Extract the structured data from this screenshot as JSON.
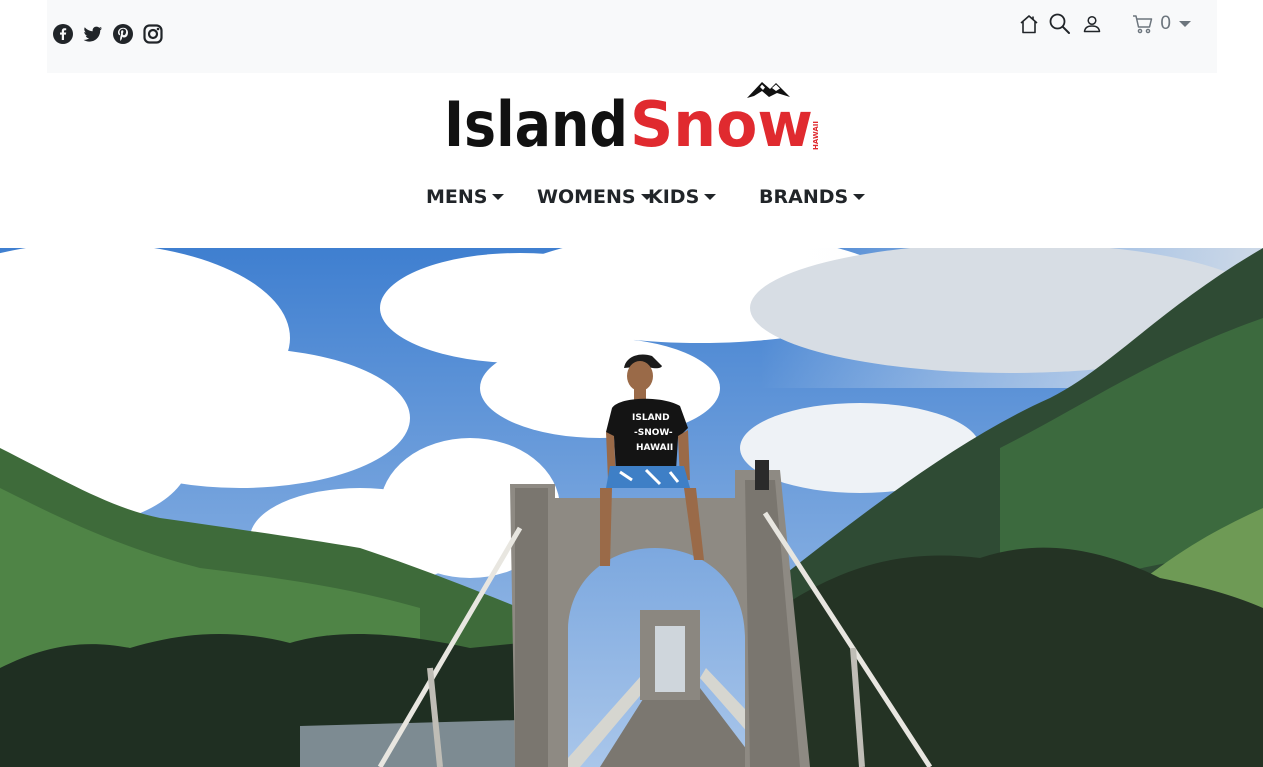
{
  "social": {
    "icons": [
      "facebook-icon",
      "twitter-icon",
      "pinterest-icon",
      "instagram-icon"
    ]
  },
  "header": {
    "cart_count": "0",
    "icons": [
      "home-icon",
      "search-icon",
      "user-icon",
      "cart-icon",
      "chevron-down-icon"
    ]
  },
  "logo": {
    "text_black": "Island",
    "text_red": "Snow",
    "tag": "HAWAII",
    "colors": {
      "black": "#111111",
      "red": "#e02a2f"
    }
  },
  "nav": {
    "items": [
      {
        "label": "MENS"
      },
      {
        "label": "WOMENS"
      },
      {
        "label": "KIDS"
      },
      {
        "label": "BRANDS"
      }
    ]
  },
  "hero": {
    "shirt_lines": [
      "ISLAND",
      "-SNOW-",
      "HAWAII"
    ],
    "colors": {
      "sky": "#5a8fd0",
      "mountain": "#3e6b3a",
      "concrete": "#8e8a83"
    }
  }
}
